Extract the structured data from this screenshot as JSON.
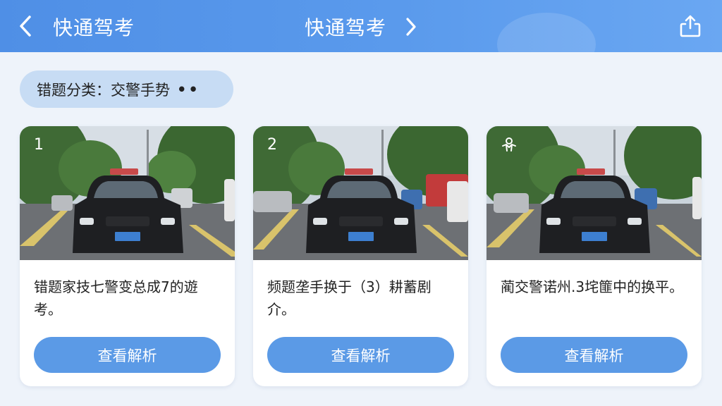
{
  "header": {
    "title": "快通驾考",
    "center_title": "快通驾考"
  },
  "filter": {
    "label": "错题分类：交警手势",
    "more": "••"
  },
  "cards": [
    {
      "number": "1",
      "question": "错题家技七警变总成7的遊考。",
      "button": "查看解析"
    },
    {
      "number": "2",
      "question": "频题垄手换于（3）耕蓄剧介。",
      "button": "查看解析"
    },
    {
      "number": "",
      "question": "蔺交警诺州.3垞篚中的换平。",
      "button": "查看解析"
    }
  ],
  "colors": {
    "header": "#5a9aec",
    "accent_button": "#5b9ae6",
    "filter_pill": "#c7dcf4",
    "background": "#eef3fa"
  }
}
